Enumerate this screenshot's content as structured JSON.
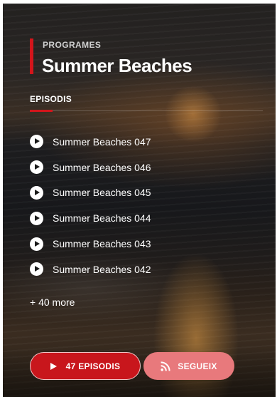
{
  "program": {
    "kicker": "PROGRAMES",
    "title": "Summer Beaches"
  },
  "episodes_section": {
    "label": "EPISODIS",
    "items": [
      {
        "label": "Summer Beaches 047"
      },
      {
        "label": "Summer Beaches 046"
      },
      {
        "label": "Summer Beaches 045"
      },
      {
        "label": "Summer Beaches 044"
      },
      {
        "label": "Summer Beaches 043"
      },
      {
        "label": "Summer Beaches 042"
      }
    ],
    "more_label": "+ 40 more"
  },
  "actions": {
    "episodes_button": "47 EPISODIS",
    "follow_button": "SEGUEIX"
  },
  "icons": {
    "episode_item": "play-circle-icon",
    "episodes_button": "play-icon",
    "follow_button": "rss-icon"
  },
  "colors": {
    "accent": "#d3151b",
    "follow_button": "#e8797c"
  }
}
